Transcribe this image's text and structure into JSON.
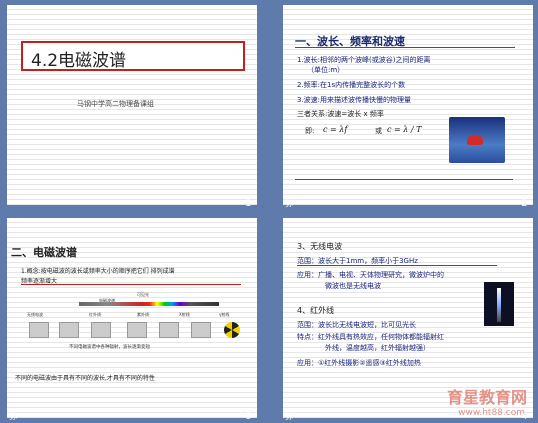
{
  "slides": [
    {
      "title": "4.2电磁波谱",
      "subtitle": "马钢中学高二物理备课组",
      "number": "1"
    },
    {
      "heading": "一、波长、频率和波速",
      "lines": [
        "1.波长:相邻的两个波峰(或波谷)之间的距离",
        "（单位:m）",
        "2.频率:在1s内传播完整波长的个数",
        "3.波速:用来描述波传播快慢的物理量",
        "三者关系:波速=波长 x 频率",
        "即:",
        "或"
      ],
      "formula1": "c = λf",
      "formula2": "c = λ / T",
      "note": "弥",
      "number": "2"
    },
    {
      "heading": "二、电磁波谱",
      "lines": [
        "1.概念:按电磁波的波长或频率大小的顺序把它们 排列成谱",
        "频率逐渐增大"
      ],
      "spectrum": {
        "top_labels": [
          "可见光"
        ],
        "bar_label": "电磁波谱",
        "band_labels": [
          "无线电波",
          "红外线",
          "紫外线",
          "X射线",
          "γ射线"
        ],
        "caption": "不同电磁波谱中各种辐射，波长逐渐变短"
      },
      "footer_line": "不同的电磁波由于具有不同的波长,才具有不同的特性",
      "note": "弥",
      "number": "3"
    },
    {
      "heading": "3、无线电波",
      "lines": [
        "范围：波长大于1mm，频率小于3GHz",
        "应用：广播、电视、天体物理研究，微波炉中的",
        "微波也是无线电波"
      ],
      "heading2": "4、红外线",
      "lines2": [
        "范围：波长比无线电波短，比可见光长",
        "特点：红外线具有热效应，任何物体都能辐射红",
        "外线，温度越高，红外辐射越强）",
        "应用：①红外线摄影②遥感③红外线加热"
      ],
      "watermark": "育星教育网",
      "watermark_url": "www.ht88.com",
      "note": "弥",
      "number": "4"
    }
  ]
}
